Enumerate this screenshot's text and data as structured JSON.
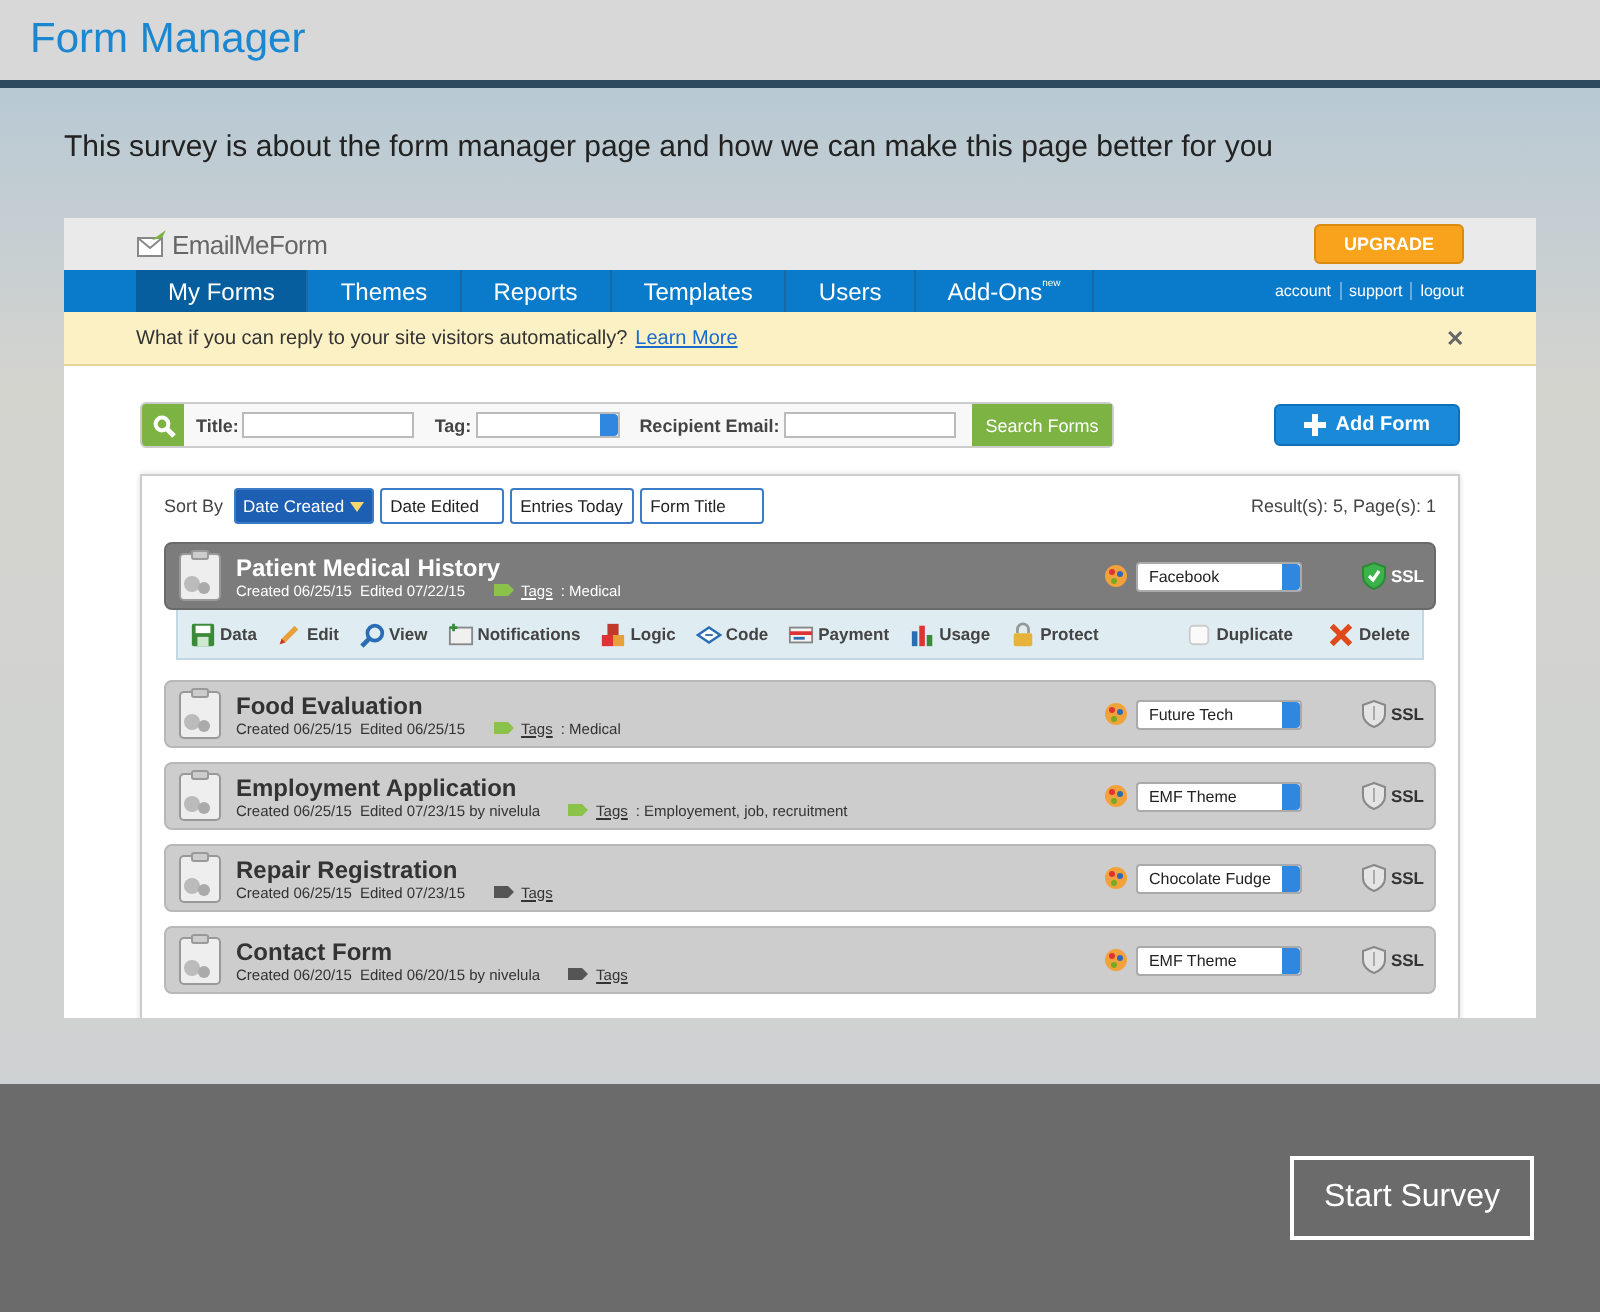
{
  "header": {
    "title": "Form Manager"
  },
  "intro": "This survey is about the form manager page and how we can make this page better for you",
  "preview": {
    "logo": "EmailMeForm",
    "upgrade": "UPGRADE",
    "nav": [
      {
        "label": "My Forms",
        "selected": true
      },
      {
        "label": "Themes",
        "selected": false
      },
      {
        "label": "Reports",
        "selected": false
      },
      {
        "label": "Templates",
        "selected": false
      },
      {
        "label": "Users",
        "selected": false
      },
      {
        "label": "Add-Ons",
        "badge": "new",
        "selected": false
      }
    ],
    "account_links": [
      "account",
      "support",
      "logout"
    ],
    "notice": {
      "text": "What if you can reply to your site visitors automatically?",
      "link": "Learn More",
      "close": "✕"
    },
    "search": {
      "title_label": "Title:",
      "tag_label": "Tag:",
      "email_label": "Recipient Email:",
      "button": "Search Forms"
    },
    "add_form": "Add Form",
    "sort": {
      "label": "Sort By",
      "options": [
        {
          "label": "Date Created",
          "selected": true
        },
        {
          "label": "Date Edited",
          "selected": false
        },
        {
          "label": "Entries Today",
          "selected": false
        },
        {
          "label": "Form Title",
          "selected": false
        }
      ]
    },
    "results": "Result(s): 5, Page(s): 1",
    "forms": [
      {
        "title": "Patient Medical History",
        "created": "Created 06/25/15",
        "edited": "Edited 07/22/15",
        "tags_label": "Tags",
        "tags_text": ": Medical",
        "color": "#8bc34a",
        "theme": "Facebook",
        "ssl": "SSL",
        "ssl_active": true,
        "selected": true
      },
      {
        "title": "Food Evaluation",
        "created": "Created 06/25/15",
        "edited": "Edited 06/25/15",
        "tags_label": "Tags",
        "tags_text": ": Medical",
        "color": "#8bc34a",
        "theme": "Future Tech",
        "ssl": "SSL",
        "ssl_active": false,
        "selected": false
      },
      {
        "title": "Employment Application",
        "created": "Created 06/25/15",
        "edited": "Edited 07/23/15 by nivelula",
        "tags_label": "Tags",
        "tags_text": ": Employement, job, recruitment",
        "color": "#8bc34a",
        "theme": "EMF Theme",
        "ssl": "SSL",
        "ssl_active": false,
        "selected": false
      },
      {
        "title": "Repair Registration",
        "created": "Created 06/25/15",
        "edited": "Edited 07/23/15",
        "tags_label": "Tags",
        "color": "#555555",
        "theme": "Chocolate Fudge",
        "ssl": "SSL",
        "ssl_active": false,
        "selected": false
      },
      {
        "title": "Contact Form",
        "created": "Created 06/20/15",
        "edited": "Edited 06/20/15 by nivelula",
        "tags_label": "Tags",
        "color": "#555555",
        "theme": "EMF Theme",
        "ssl": "SSL",
        "ssl_active": false,
        "selected": false
      }
    ],
    "actions": [
      {
        "label": "Data",
        "kind": "save"
      },
      {
        "label": "Edit",
        "kind": "pencil"
      },
      {
        "label": "View",
        "kind": "magnifier"
      },
      {
        "label": "Notifications",
        "kind": "note"
      },
      {
        "label": "Logic",
        "kind": "blocks"
      },
      {
        "label": "Code",
        "kind": "code"
      },
      {
        "label": "Payment",
        "kind": "card"
      },
      {
        "label": "Usage",
        "kind": "bars"
      },
      {
        "label": "Protect",
        "kind": "lock"
      },
      {
        "label": "Duplicate",
        "kind": "copy"
      },
      {
        "label": "Delete",
        "kind": "delete"
      }
    ]
  },
  "start_button": "Start Survey"
}
